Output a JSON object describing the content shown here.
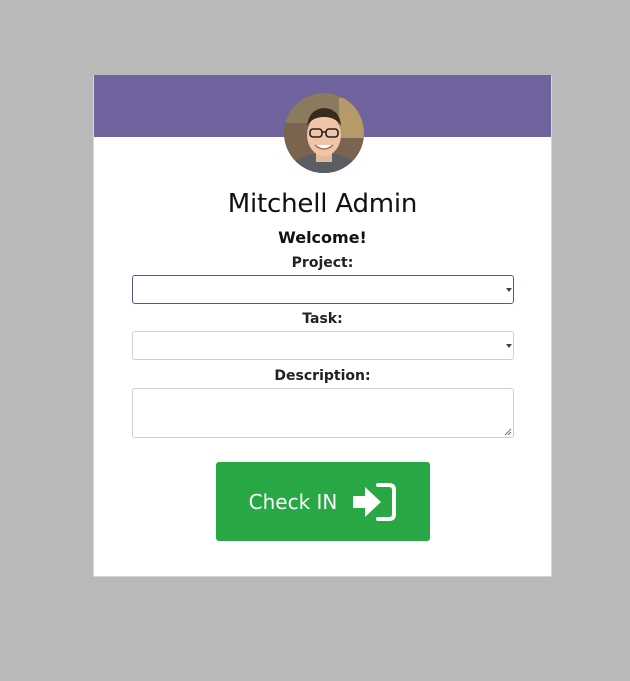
{
  "user": {
    "name": "Mitchell Admin",
    "welcome": "Welcome!"
  },
  "form": {
    "project_label": "Project:",
    "project_value": "",
    "task_label": "Task:",
    "task_value": "",
    "description_label": "Description:",
    "description_value": ""
  },
  "actions": {
    "check_in_label": "Check IN",
    "check_in_icon": "sign-in-icon"
  },
  "colors": {
    "header": "#71639e",
    "button": "#28a745",
    "background": "#b8b9b8"
  }
}
